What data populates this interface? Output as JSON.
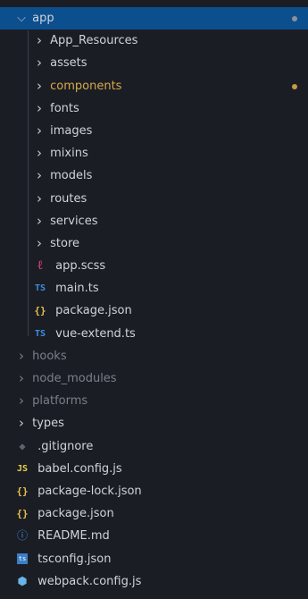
{
  "explorer": {
    "root": {
      "label": "app",
      "expanded": true,
      "status_dot": "grey"
    },
    "app_children": [
      {
        "label": "App_Resources",
        "kind": "folder"
      },
      {
        "label": "assets",
        "kind": "folder"
      },
      {
        "label": "components",
        "kind": "folder",
        "modified": true
      },
      {
        "label": "fonts",
        "kind": "folder"
      },
      {
        "label": "images",
        "kind": "folder"
      },
      {
        "label": "mixins",
        "kind": "folder"
      },
      {
        "label": "models",
        "kind": "folder"
      },
      {
        "label": "routes",
        "kind": "folder"
      },
      {
        "label": "services",
        "kind": "folder"
      },
      {
        "label": "store",
        "kind": "folder"
      },
      {
        "label": "app.scss",
        "kind": "file",
        "icon": "scss-icon"
      },
      {
        "label": "main.ts",
        "kind": "file",
        "icon": "typescript-icon"
      },
      {
        "label": "package.json",
        "kind": "file",
        "icon": "json-icon"
      },
      {
        "label": "vue-extend.ts",
        "kind": "file",
        "icon": "typescript-icon"
      }
    ],
    "top_level": [
      {
        "label": "hooks",
        "kind": "folder",
        "dimmed": true
      },
      {
        "label": "node_modules",
        "kind": "folder",
        "dimmed": true
      },
      {
        "label": "platforms",
        "kind": "folder",
        "dimmed": true
      },
      {
        "label": "types",
        "kind": "folder"
      },
      {
        "label": ".gitignore",
        "kind": "file",
        "icon": "git-icon"
      },
      {
        "label": "babel.config.js",
        "kind": "file",
        "icon": "javascript-icon"
      },
      {
        "label": "package-lock.json",
        "kind": "file",
        "icon": "json-icon"
      },
      {
        "label": "package.json",
        "kind": "file",
        "icon": "json-icon"
      },
      {
        "label": "README.md",
        "kind": "file",
        "icon": "info-icon"
      },
      {
        "label": "tsconfig.json",
        "kind": "file",
        "icon": "tsconfig-icon"
      },
      {
        "label": "webpack.config.js",
        "kind": "file",
        "icon": "webpack-icon"
      }
    ],
    "icon_glyphs": {
      "ts": "TS",
      "js": "JS",
      "json": "{}",
      "tsconfig": "ts"
    }
  },
  "colors": {
    "background": "#1b1d24",
    "selected_row": "#0c4f8f",
    "modified_text": "#d7a94b",
    "dimmed_text": "#7a7f89"
  }
}
